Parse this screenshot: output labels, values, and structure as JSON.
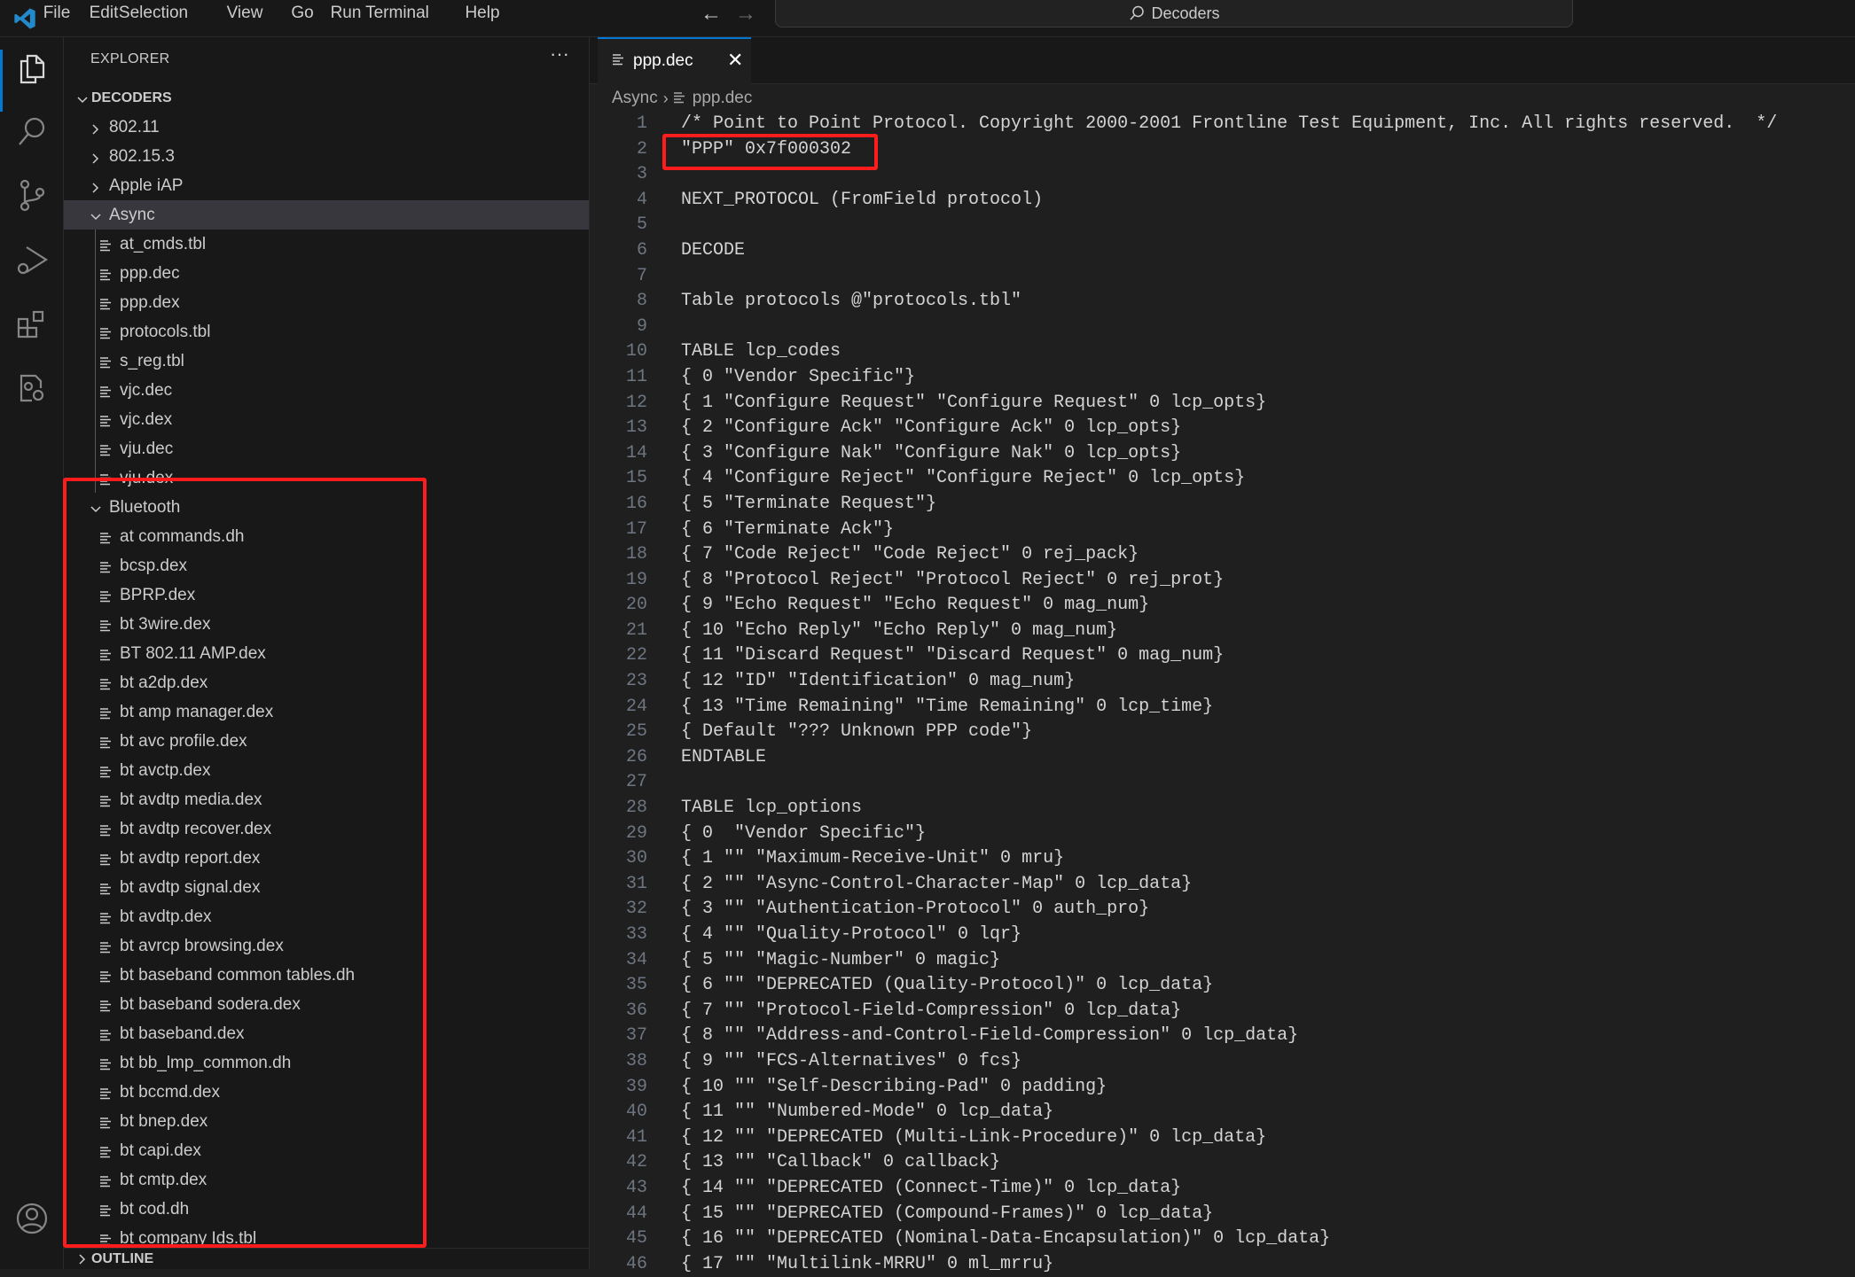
{
  "menubar": {
    "items": [
      "File",
      "Edit",
      "Selection",
      "View",
      "Go",
      "Run",
      "Terminal",
      "Help"
    ],
    "search_text": "Decoders",
    "back_icon": "arrow-left-icon",
    "forward_icon": "arrow-right-icon"
  },
  "activity_bar": {
    "items": [
      "explorer-icon",
      "search-icon",
      "source-control-icon",
      "run-debug-icon",
      "extensions-icon",
      "remote-settings-icon"
    ],
    "account_icon": "account-icon"
  },
  "sidebar": {
    "title": "EXPLORER",
    "more": "···",
    "root": "DECODERS",
    "tree": [
      {
        "type": "folder",
        "label": "802.11",
        "depth": 0,
        "expanded": false
      },
      {
        "type": "folder",
        "label": "802.15.3",
        "depth": 0,
        "expanded": false
      },
      {
        "type": "folder",
        "label": "Apple iAP",
        "depth": 0,
        "expanded": false
      },
      {
        "type": "folder",
        "label": "Async",
        "depth": 0,
        "expanded": true,
        "selected": true
      },
      {
        "type": "file",
        "label": "at_cmds.tbl",
        "depth": 1
      },
      {
        "type": "file",
        "label": "ppp.dec",
        "depth": 1
      },
      {
        "type": "file",
        "label": "ppp.dex",
        "depth": 1
      },
      {
        "type": "file",
        "label": "protocols.tbl",
        "depth": 1
      },
      {
        "type": "file",
        "label": "s_reg.tbl",
        "depth": 1
      },
      {
        "type": "file",
        "label": "vjc.dec",
        "depth": 1
      },
      {
        "type": "file",
        "label": "vjc.dex",
        "depth": 1
      },
      {
        "type": "file",
        "label": "vju.dec",
        "depth": 1
      },
      {
        "type": "file",
        "label": "vju.dex",
        "depth": 1
      },
      {
        "type": "folder",
        "label": "Bluetooth",
        "depth": 0,
        "expanded": true
      },
      {
        "type": "file",
        "label": "at commands.dh",
        "depth": 1
      },
      {
        "type": "file",
        "label": "bcsp.dex",
        "depth": 1
      },
      {
        "type": "file",
        "label": "BPRP.dex",
        "depth": 1
      },
      {
        "type": "file",
        "label": "bt 3wire.dex",
        "depth": 1
      },
      {
        "type": "file",
        "label": "BT 802.11 AMP.dex",
        "depth": 1
      },
      {
        "type": "file",
        "label": "bt a2dp.dex",
        "depth": 1
      },
      {
        "type": "file",
        "label": "bt amp manager.dex",
        "depth": 1
      },
      {
        "type": "file",
        "label": "bt avc profile.dex",
        "depth": 1
      },
      {
        "type": "file",
        "label": "bt avctp.dex",
        "depth": 1
      },
      {
        "type": "file",
        "label": "bt avdtp media.dex",
        "depth": 1
      },
      {
        "type": "file",
        "label": "bt avdtp recover.dex",
        "depth": 1
      },
      {
        "type": "file",
        "label": "bt avdtp report.dex",
        "depth": 1
      },
      {
        "type": "file",
        "label": "bt avdtp signal.dex",
        "depth": 1
      },
      {
        "type": "file",
        "label": "bt avdtp.dex",
        "depth": 1
      },
      {
        "type": "file",
        "label": "bt avrcp browsing.dex",
        "depth": 1
      },
      {
        "type": "file",
        "label": "bt baseband common tables.dh",
        "depth": 1
      },
      {
        "type": "file",
        "label": "bt baseband sodera.dex",
        "depth": 1
      },
      {
        "type": "file",
        "label": "bt baseband.dex",
        "depth": 1
      },
      {
        "type": "file",
        "label": "bt bb_lmp_common.dh",
        "depth": 1
      },
      {
        "type": "file",
        "label": "bt bccmd.dex",
        "depth": 1
      },
      {
        "type": "file",
        "label": "bt bnep.dex",
        "depth": 1
      },
      {
        "type": "file",
        "label": "bt capi.dex",
        "depth": 1
      },
      {
        "type": "file",
        "label": "bt cmtp.dex",
        "depth": 1
      },
      {
        "type": "file",
        "label": "bt cod.dh",
        "depth": 1
      },
      {
        "type": "file",
        "label": "bt company Ids.tbl",
        "depth": 1
      }
    ],
    "outline_label": "OUTLINE"
  },
  "editor": {
    "tab": {
      "label": "ppp.dec",
      "close": "✕"
    },
    "breadcrumb": [
      "Async",
      "ppp.dec"
    ],
    "lines": [
      "/* Point to Point Protocol. Copyright 2000-2001 Frontline Test Equipment, Inc. All rights reserved.  */",
      "\"PPP\" 0x7f000302",
      "",
      "NEXT_PROTOCOL (FromField protocol)",
      "",
      "DECODE",
      "",
      "Table protocols @\"protocols.tbl\"",
      "",
      "TABLE lcp_codes",
      "{ 0 \"Vendor Specific\"}",
      "{ 1 \"Configure Request\" \"Configure Request\" 0 lcp_opts}",
      "{ 2 \"Configure Ack\" \"Configure Ack\" 0 lcp_opts}",
      "{ 3 \"Configure Nak\" \"Configure Nak\" 0 lcp_opts}",
      "{ 4 \"Configure Reject\" \"Configure Reject\" 0 lcp_opts}",
      "{ 5 \"Terminate Request\"}",
      "{ 6 \"Terminate Ack\"}",
      "{ 7 \"Code Reject\" \"Code Reject\" 0 rej_pack}",
      "{ 8 \"Protocol Reject\" \"Protocol Reject\" 0 rej_prot}",
      "{ 9 \"Echo Request\" \"Echo Request\" 0 mag_num}",
      "{ 10 \"Echo Reply\" \"Echo Reply\" 0 mag_num}",
      "{ 11 \"Discard Request\" \"Discard Request\" 0 mag_num}",
      "{ 12 \"ID\" \"Identification\" 0 mag_num}",
      "{ 13 \"Time Remaining\" \"Time Remaining\" 0 lcp_time}",
      "{ Default \"??? Unknown PPP code\"}",
      "ENDTABLE",
      "",
      "TABLE lcp_options",
      "{ 0  \"Vendor Specific\"}",
      "{ 1 \"\" \"Maximum-Receive-Unit\" 0 mru}",
      "{ 2 \"\" \"Async-Control-Character-Map\" 0 lcp_data}",
      "{ 3 \"\" \"Authentication-Protocol\" 0 auth_pro}",
      "{ 4 \"\" \"Quality-Protocol\" 0 lqr}",
      "{ 5 \"\" \"Magic-Number\" 0 magic}",
      "{ 6 \"\" \"DEPRECATED (Quality-Protocol)\" 0 lcp_data}",
      "{ 7 \"\" \"Protocol-Field-Compression\" 0 lcp_data}",
      "{ 8 \"\" \"Address-and-Control-Field-Compression\" 0 lcp_data}",
      "{ 9 \"\" \"FCS-Alternatives\" 0 fcs}",
      "{ 10 \"\" \"Self-Describing-Pad\" 0 padding}",
      "{ 11 \"\" \"Numbered-Mode\" 0 lcp_data}",
      "{ 12 \"\" \"DEPRECATED (Multi-Link-Procedure)\" 0 lcp_data}",
      "{ 13 \"\" \"Callback\" 0 callback}",
      "{ 14 \"\" \"DEPRECATED (Connect-Time)\" 0 lcp_data}",
      "{ 15 \"\" \"DEPRECATED (Compound-Frames)\" 0 lcp_data}",
      "{ 16 \"\" \"DEPRECATED (Nominal-Data-Encapsulation)\" 0 lcp_data}",
      "{ 17 \"\" \"Multilink-MRRU\" 0 ml_mrru}"
    ]
  },
  "annotations": {
    "highlight_color": "#ff1c1c"
  },
  "colors": {
    "accent": "#0078d4",
    "editor_bg": "#1f1f1f",
    "sidebar_bg": "#181818",
    "selection_bg": "#37373d"
  }
}
